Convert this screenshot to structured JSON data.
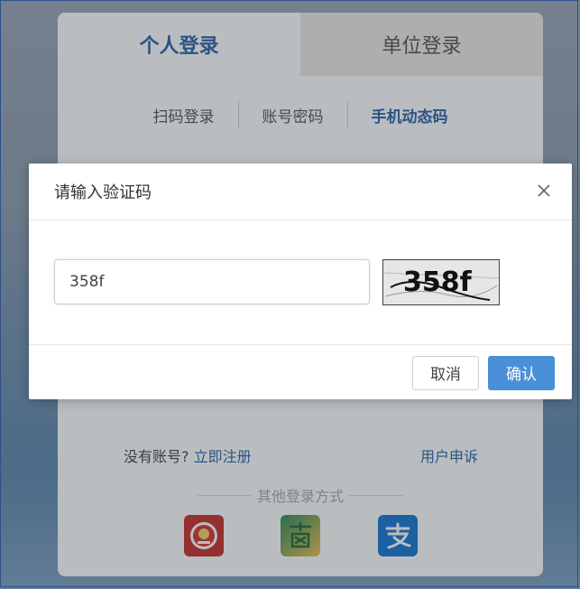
{
  "login_card": {
    "tabs": [
      {
        "label": "个人登录",
        "active": true
      },
      {
        "label": "单位登录",
        "active": false
      }
    ],
    "subtabs": [
      {
        "label": "扫码登录"
      },
      {
        "label": "账号密码"
      },
      {
        "label": "手机动态码"
      }
    ],
    "register_prompt": "没有账号?",
    "register_link": "立即注册",
    "appeal_link": "用户申诉",
    "other_login_label": "其他登录方式",
    "other_login_icons": [
      "emblem-icon",
      "su-app-icon",
      "alipay-icon"
    ]
  },
  "captcha_dialog": {
    "title": "请输入验证码",
    "close_symbol": "X",
    "input_value": "358f",
    "captcha_text": "358f",
    "cancel_label": "取消",
    "confirm_label": "确认"
  },
  "colors": {
    "accent": "#2d63a8",
    "primary_button": "#4a90d9"
  }
}
